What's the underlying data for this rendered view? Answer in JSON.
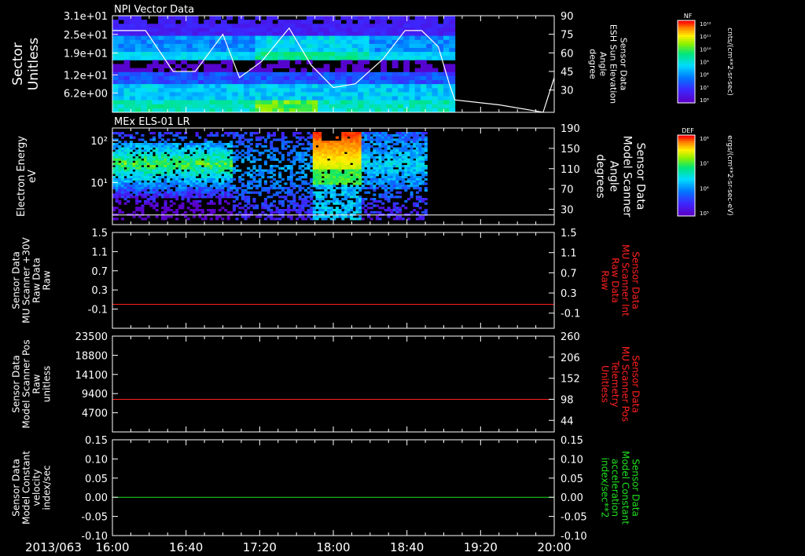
{
  "chart_data": [
    {
      "type": "heatmap",
      "title": "NPI Vector Data",
      "ylabel_left": [
        "Sector",
        "Unitless"
      ],
      "left_ticks": [
        "3.1e+01",
        "2.5e+01",
        "1.9e+01",
        "1.2e+01",
        "6.2e+00"
      ],
      "left_tick_values": [
        31,
        25,
        19,
        12,
        6.2
      ],
      "left_ylim": [
        0,
        31
      ],
      "ylabel_right": [
        "Sensor Data",
        "ESH Sun Elevation",
        "Angle",
        "degree"
      ],
      "right_ticks": [
        "90",
        "75",
        "60",
        "45",
        "30"
      ],
      "right_tick_values": [
        90,
        75,
        60,
        45,
        30
      ],
      "right_ylim": [
        12,
        90
      ],
      "colorbar": {
        "label": "NF",
        "ticks": [
          "10¹²",
          "10¹¹",
          "10¹⁰",
          "10⁹",
          "10⁸",
          "10⁷",
          "10⁶"
        ],
        "units": "cnts/(cm**2-sr-sec)"
      },
      "data_coverage_hours": [
        16.0,
        19.1
      ],
      "line_series": {
        "name": "ESH Sun Elevation Angle",
        "color": "#ffffff",
        "x_hours": [
          16.0,
          16.3,
          16.55,
          16.75,
          17.0,
          17.15,
          17.35,
          17.6,
          17.8,
          18.0,
          18.2,
          18.45,
          18.65,
          18.8,
          18.95,
          19.05,
          19.1,
          19.5,
          19.9,
          20.0
        ],
        "y_deg": [
          78,
          78,
          45,
          45,
          75,
          40,
          53,
          80,
          50,
          32,
          35,
          55,
          78,
          78,
          65,
          35,
          22,
          18,
          12,
          40
        ]
      }
    },
    {
      "type": "heatmap",
      "title": "MEx ELS-01 LR",
      "ylabel_left": [
        "Electron Energy",
        "eV"
      ],
      "left_ticks": [
        "10²",
        "10¹"
      ],
      "left_tick_values": [
        100,
        10
      ],
      "left_ylim": [
        1,
        200
      ],
      "left_scale": "log",
      "ylabel_right": [
        "Sensor Data",
        "Model Scanner",
        "Angle",
        "degrees"
      ],
      "right_ticks": [
        "190",
        "150",
        "110",
        "70",
        "30"
      ],
      "right_tick_values": [
        190,
        150,
        110,
        70,
        30
      ],
      "right_ylim": [
        0,
        190
      ],
      "colorbar": {
        "label": "DEF",
        "ticks": [
          "10⁸",
          "10⁷",
          "10⁶",
          "10⁵"
        ],
        "units": "ergs/(cm**2-sr-sec-eV)"
      },
      "data_coverage_hours": [
        16.0,
        18.85
      ],
      "line_series": {
        "name": "Model Scanner Angle",
        "color": "#ffffff",
        "x_hours": [
          16.0,
          20.0
        ],
        "y_deg": [
          2,
          2
        ]
      }
    },
    {
      "type": "line",
      "ylabel_left": [
        "Sensor Data",
        "MU Scanner +30V",
        "Raw Data",
        "Raw"
      ],
      "left_ticks": [
        "1.5",
        "1.1",
        "0.7",
        "0.3",
        "-0.1"
      ],
      "left_tick_values": [
        1.5,
        1.1,
        0.7,
        0.3,
        -0.1
      ],
      "left_ylim": [
        -0.5,
        1.5
      ],
      "ylabel_right": [
        "Sensor Data",
        "MU Scanner Int",
        "Raw Data",
        "Raw"
      ],
      "right_ticks": [
        "1.5",
        "1.1",
        "0.7",
        "0.3",
        "-0.1"
      ],
      "right_label_color": "#ff2020",
      "series": [
        {
          "color": "#ff2020",
          "x_hours": [
            16.0,
            20.0
          ],
          "y": [
            0.0,
            0.0
          ]
        }
      ]
    },
    {
      "type": "line",
      "ylabel_left": [
        "Sensor Data",
        "Model Scanner Pos",
        "Raw",
        "unitless"
      ],
      "left_ticks": [
        "23500",
        "18800",
        "14100",
        "9400",
        "4700"
      ],
      "left_tick_values": [
        23500,
        18800,
        14100,
        9400,
        4700
      ],
      "left_ylim": [
        0,
        23500
      ],
      "ylabel_right": [
        "Sensor Data",
        "MU Scanner Pos",
        "Telemetry",
        "Unitless"
      ],
      "right_ticks": [
        "260",
        "206",
        "152",
        "98",
        "44"
      ],
      "right_label_color": "#ff2020",
      "series": [
        {
          "color": "#ff2020",
          "x_hours": [
            16.0,
            20.0
          ],
          "y": [
            8000,
            8000
          ]
        }
      ]
    },
    {
      "type": "line",
      "ylabel_left": [
        "Sensor Data",
        "Model Constant",
        "velocity",
        "index/sec"
      ],
      "left_ticks": [
        "0.15",
        "0.10",
        "0.05",
        "0.00",
        "-0.05",
        "-0.10"
      ],
      "left_tick_values": [
        0.15,
        0.1,
        0.05,
        0.0,
        -0.05,
        -0.1
      ],
      "left_ylim": [
        -0.1,
        0.15
      ],
      "ylabel_right": [
        "Sensor Data",
        "Model Constant",
        "acceleration",
        "index/sec**2"
      ],
      "right_ticks": [
        "0.15",
        "0.10",
        "0.05",
        "0.00",
        "-0.05",
        "-0.10"
      ],
      "right_label_color": "#20e020",
      "series": [
        {
          "color": "#20e020",
          "x_hours": [
            16.0,
            20.0
          ],
          "y": [
            0.0,
            0.0
          ]
        }
      ]
    }
  ],
  "x_axis": {
    "date_label": "2013/063",
    "ticks": [
      "16:00",
      "16:40",
      "17:20",
      "18:00",
      "18:40",
      "19:20",
      "20:00"
    ],
    "tick_hours": [
      16.0,
      16.6667,
      17.3333,
      18.0,
      18.6667,
      19.3333,
      20.0
    ],
    "range_hours": [
      16.0,
      20.0
    ]
  }
}
